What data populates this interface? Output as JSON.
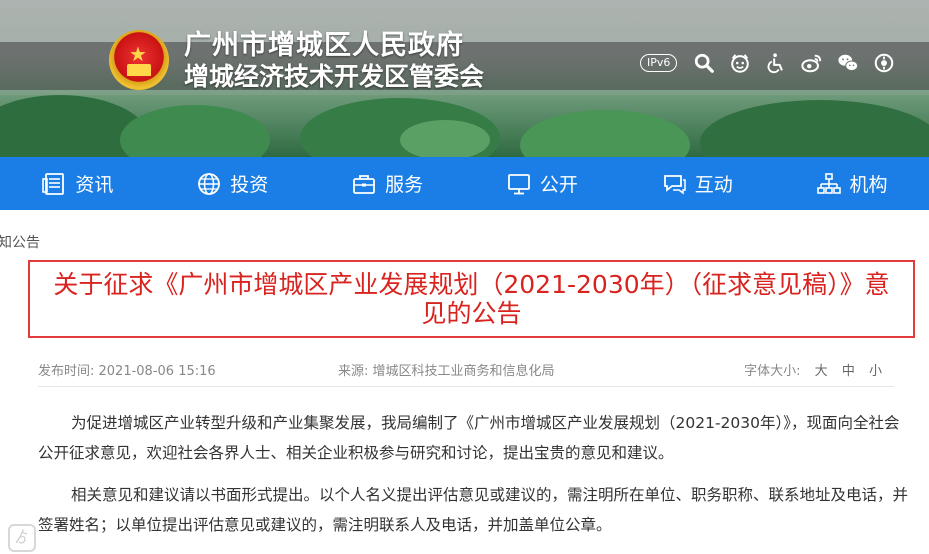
{
  "header": {
    "title": "广州市增城区人民政府",
    "subtitle": "增城经济技术开发区管委会",
    "ipv6": "IPv6",
    "tools": [
      {
        "icon": "search-icon"
      },
      {
        "icon": "elderly-mode-icon"
      },
      {
        "icon": "accessibility-icon"
      },
      {
        "icon": "weibo-icon"
      },
      {
        "icon": "wechat-icon"
      },
      {
        "icon": "settings-icon"
      }
    ]
  },
  "nav": {
    "items": [
      {
        "label": "资讯",
        "icon": "news-icon"
      },
      {
        "label": "投资",
        "icon": "globe-icon"
      },
      {
        "label": "服务",
        "icon": "briefcase-icon"
      },
      {
        "label": "公开",
        "icon": "monitor-icon"
      },
      {
        "label": "互动",
        "icon": "chat-icon"
      },
      {
        "label": "机构",
        "icon": "org-chart-icon"
      }
    ]
  },
  "breadcrumb": "知公告",
  "article": {
    "title": "关于征求《广州市增城区产业发展规划（2021-2030年）（征求意见稿）》意见的公告",
    "publish_time": "发布时间: 2021-08-06 15:16",
    "source": "来源: 增城区科技工业商务和信息化局",
    "font_size_label": "字体大小:",
    "font_sizes": [
      "大",
      "中",
      "小"
    ],
    "paragraphs": [
      "为促进增城区产业转型升级和产业集聚发展，我局编制了《广州市增城区产业发展规划（2021-2030年）》，现面向全社会公开征求意见，欢迎社会各界人士、相关企业积极参与研究和讨论，提出宝贵的意见和建议。",
      "相关意见和建议请以书面形式提出。以个人名义提出评估意见或建议的，需注明所在单位、职务职称、联系地址及电话，并签署姓名；以单位提出评估意见或建议的，需注明联系人及电话，并加盖单位公章。"
    ]
  },
  "colors": {
    "nav_bg": "#1a7ee6",
    "title_red": "#d9231f",
    "title_border": "#e23b3b"
  }
}
